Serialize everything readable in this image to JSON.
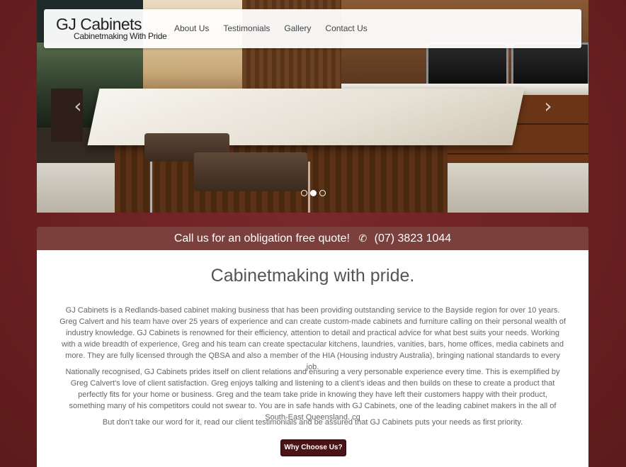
{
  "brand": {
    "name": "GJ Cabinets",
    "tagline": "Cabinetmaking With Pride"
  },
  "nav": {
    "items": [
      "About Us",
      "Testimonials",
      "Gallery",
      "Contact Us"
    ]
  },
  "carousel": {
    "prev_icon": "chevron-left-icon",
    "next_icon": "chevron-right-icon",
    "slide_count": 3,
    "active_slide": 2
  },
  "callbar": {
    "text": "Call us for an obligation free quote!",
    "phone_icon": "phone-icon",
    "phone": "(07) 3823 1044"
  },
  "main": {
    "heading": "Cabinetmaking with pride.",
    "paragraphs": [
      "GJ Cabinets is a Redlands-based cabinet making business that has been providing outstanding service to the Bayside region for over 10 years. Greg Calvert and his team have over 25 years of experience and can create custom-made cabinets and furniture calling on their personal wealth of industry knowledge. GJ Cabinets is renowned for their efficiency, attention to detail and practical advice for what best suits your needs. Working with a wide breadth of experience, Greg and his team can create spectacular kitchens, laundries, vanities, bars, home offices, media cabinets and more. They are fully licensed through the QBSA and also a member of the HIA (Housing industry Australia), bringing national standards to every job.",
      "Nationally recognised, GJ Cabinets prides itself on client relations and ensuring a very personable experience every time. This is exemplified by Greg Calvert's love of client satisfaction. Greg enjoys talking and listening to a client's ideas and then builds on these to create a product that perfectly fits for your home or business. Greg and the team take pride in knowing they have left their customers happy with their product, something many of his competitors could not swear to. You are in safe hands with GJ Cabinets, one of the leading cabinet makers in the all of South-East Queensland. cq",
      "But don't take our word for it, read our client testimonials and be assured that GJ Cabinets puts your needs as first priority."
    ],
    "cta_label": "Why Choose Us?"
  },
  "colors": {
    "page_bg": "#6b1f20",
    "callbar_bg": "#7b3f3c",
    "cta_bg": "#4a1417"
  }
}
